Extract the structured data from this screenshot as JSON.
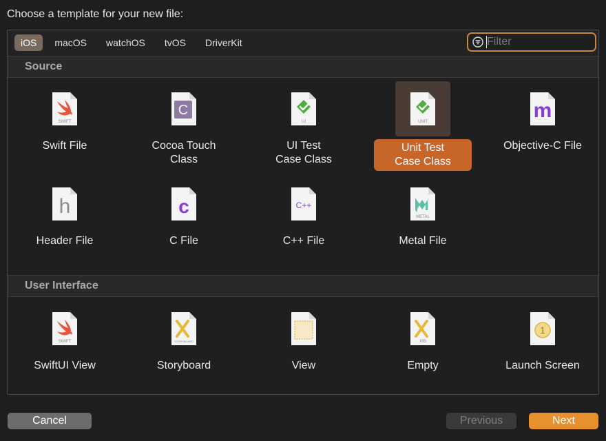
{
  "dialog": {
    "title": "Choose a template for your new file:"
  },
  "tabs": [
    {
      "label": "iOS",
      "active": true
    },
    {
      "label": "macOS",
      "active": false
    },
    {
      "label": "watchOS",
      "active": false
    },
    {
      "label": "tvOS",
      "active": false
    },
    {
      "label": "DriverKit",
      "active": false
    }
  ],
  "filter": {
    "placeholder": "Filter",
    "value": ""
  },
  "sections": [
    {
      "title": "Source",
      "items": [
        {
          "line1": "Swift File",
          "line2": "",
          "icon": "swift-file-icon",
          "caption": "SWIFT"
        },
        {
          "line1": "Cocoa Touch",
          "line2": "Class",
          "icon": "cocoa-touch-class-icon",
          "caption": ""
        },
        {
          "line1": "UI Test",
          "line2": "Case Class",
          "icon": "ui-test-icon",
          "caption": "UI"
        },
        {
          "line1": "Unit Test",
          "line2": "Case Class",
          "icon": "unit-test-icon",
          "caption": "UNIT",
          "selected": true
        },
        {
          "line1": "Objective-C File",
          "line2": "",
          "icon": "objective-c-file-icon",
          "caption": ""
        },
        {
          "line1": "Header File",
          "line2": "",
          "icon": "header-file-icon",
          "caption": ""
        },
        {
          "line1": "C File",
          "line2": "",
          "icon": "c-file-icon",
          "caption": ""
        },
        {
          "line1": "C++ File",
          "line2": "",
          "icon": "cpp-file-icon",
          "caption": ""
        },
        {
          "line1": "Metal File",
          "line2": "",
          "icon": "metal-file-icon",
          "caption": "METAL"
        }
      ]
    },
    {
      "title": "User Interface",
      "items": [
        {
          "line1": "SwiftUI View",
          "line2": "",
          "icon": "swiftui-view-icon",
          "caption": "SWIFT"
        },
        {
          "line1": "Storyboard",
          "line2": "",
          "icon": "storyboard-icon",
          "caption": "STORYBOARD"
        },
        {
          "line1": "View",
          "line2": "",
          "icon": "view-icon",
          "caption": ""
        },
        {
          "line1": "Empty",
          "line2": "",
          "icon": "empty-xib-icon",
          "caption": "XIB"
        },
        {
          "line1": "Launch Screen",
          "line2": "",
          "icon": "launch-screen-icon",
          "caption": ""
        }
      ]
    }
  ],
  "glyphs": {
    "cocoa": "C",
    "objc": "m",
    "header": "h",
    "c": "c",
    "cpp": "C++",
    "launch": "1"
  },
  "buttons": {
    "cancel": "Cancel",
    "previous": "Previous",
    "next": "Next"
  },
  "colors": {
    "accent": "#c8662a",
    "next": "#e8902e",
    "filter_focus": "#c88a3a"
  }
}
